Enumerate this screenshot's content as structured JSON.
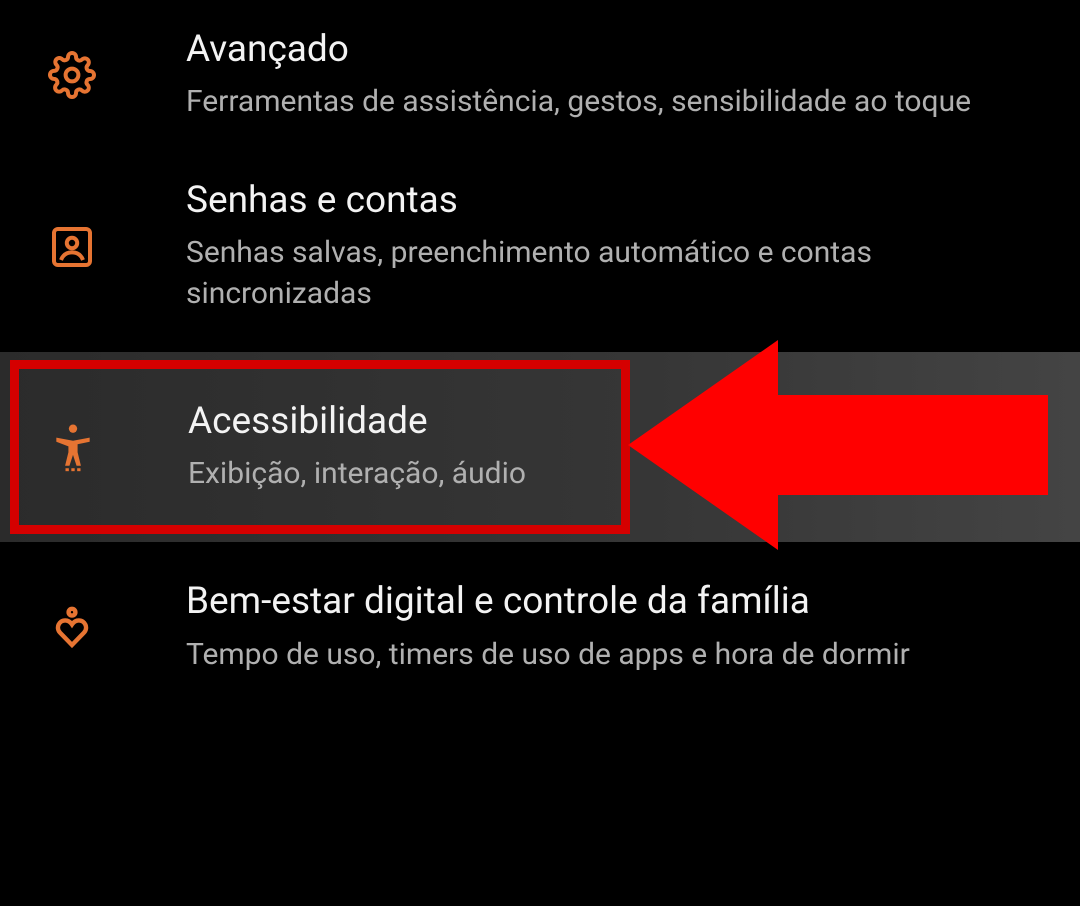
{
  "settings": {
    "items": [
      {
        "icon": "gear",
        "title": "Avançado",
        "subtitle": "Ferramentas de assistência, gestos, sensibilidade ao toque"
      },
      {
        "icon": "account",
        "title": "Senhas e contas",
        "subtitle": "Senhas salvas, preenchimento automático e contas sincronizadas"
      },
      {
        "icon": "accessibility",
        "title": "Acessibilidade",
        "subtitle": "Exibição, interação, áudio"
      },
      {
        "icon": "wellbeing",
        "title": "Bem-estar digital e controle da família",
        "subtitle": "Tempo de uso, timers de uso de apps e hora de dormir"
      }
    ]
  },
  "annotation": {
    "highlighted_index": 2,
    "highlight_color": "#d50000",
    "arrow_color": "#ff0000"
  },
  "colors": {
    "accent": "#e67432",
    "text_primary": "#f3f3f3",
    "text_secondary": "#b0b0b0",
    "background": "#000000"
  }
}
